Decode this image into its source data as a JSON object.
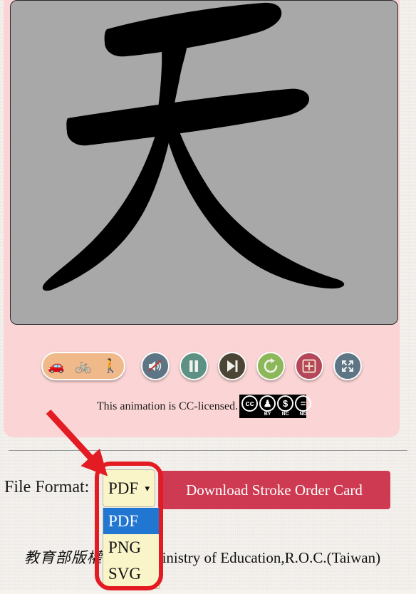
{
  "page": {
    "background_color": "#f7f4f0",
    "panel_color": "#fbd5d5",
    "canvas_color": "#a8a8a8",
    "accent_color": "#ce3a51",
    "highlight_color": "#e31b23"
  },
  "animation": {
    "character": "天",
    "canvas_label": "stroke-order-animation-canvas"
  },
  "controls": {
    "speed": {
      "label": "speed-selector",
      "options": [
        {
          "icon": "car-icon",
          "glyph": "🚗",
          "speed": "fast"
        },
        {
          "icon": "bicycle-icon",
          "glyph": "🚲",
          "speed": "medium"
        },
        {
          "icon": "walking-person-icon",
          "glyph": "🚶",
          "speed": "slow"
        }
      ]
    },
    "buttons": [
      {
        "name": "mute-button",
        "icon": "mute-icon",
        "color": "#5e7586",
        "tooltip": "Mute"
      },
      {
        "name": "pause-button",
        "icon": "pause-icon",
        "color": "#5d9183",
        "tooltip": "Pause"
      },
      {
        "name": "next-step-button",
        "icon": "next-step-icon",
        "color": "#4c4434",
        "tooltip": "Next Step"
      },
      {
        "name": "replay-button",
        "icon": "replay-icon",
        "color": "#8cb85a",
        "tooltip": "Replay"
      },
      {
        "name": "grid-toggle-button",
        "icon": "grid-plus-icon",
        "color": "#b4475a",
        "tooltip": "Toggle Grid"
      },
      {
        "name": "fullscreen-button",
        "icon": "fullscreen-icon",
        "color": "#5e7586",
        "tooltip": "Fullscreen"
      }
    ]
  },
  "license": {
    "text": "This animation is CC-licensed.",
    "badge": {
      "name": "cc-by-nc-nd-badge",
      "marks": [
        {
          "symbol": "cc",
          "abbr": ""
        },
        {
          "symbol": "Ɨ",
          "abbr": "BY"
        },
        {
          "symbol": "$",
          "abbr": "NC"
        },
        {
          "symbol": "=",
          "abbr": "ND"
        }
      ]
    }
  },
  "form": {
    "file_format_label": "File Format:",
    "select": {
      "name": "file-format-select",
      "value": "PDF",
      "expanded": true,
      "options": [
        "PDF",
        "PNG",
        "SVG"
      ],
      "selected_index": 0
    },
    "download_button_label": "Download Stroke Order Card"
  },
  "footer": {
    "chinese": "教育部版權所有",
    "english": "Ministry of Education,R.O.C.(Taiwan)"
  }
}
